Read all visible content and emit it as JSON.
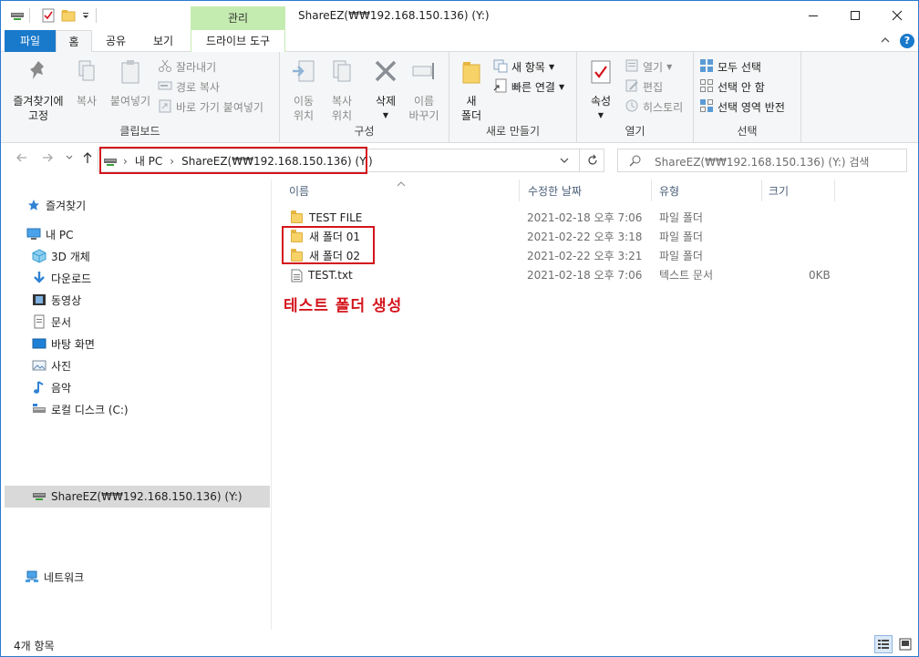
{
  "window": {
    "title": "ShareEZ(₩₩192.168.150.136) (Y:)",
    "context_tab_group": "관리"
  },
  "tabs": {
    "file": "파일",
    "home": "홈",
    "share": "공유",
    "view": "보기",
    "drive_tools": "드라이브 도구"
  },
  "ribbon": {
    "clipboard": {
      "label": "클립보드",
      "pin_line1": "즐겨찾기에",
      "pin_line2": "고정",
      "copy": "복사",
      "paste": "붙여넣기",
      "cut": "잘라내기",
      "copy_path": "경로 복사",
      "paste_shortcut": "바로 가기 붙여넣기"
    },
    "organize": {
      "label": "구성",
      "move_line1": "이동",
      "move_line2": "위치",
      "copyto_line1": "복사",
      "copyto_line2": "위치",
      "delete": "삭제",
      "rename_line1": "이름",
      "rename_line2": "바꾸기"
    },
    "new": {
      "label": "새로 만들기",
      "new_folder_line1": "새",
      "new_folder_line2": "폴더",
      "new_item": "새 항목",
      "easy_access": "빠른 연결"
    },
    "open": {
      "label": "열기",
      "properties": "속성",
      "open": "열기",
      "edit": "편집",
      "history": "히스토리"
    },
    "select": {
      "label": "선택",
      "select_all": "모두 선택",
      "select_none": "선택 안 함",
      "invert": "선택 영역 반전"
    }
  },
  "address": {
    "crumb_pc": "내 PC",
    "crumb_drive": "ShareEZ(₩₩192.168.150.136) (Y:)",
    "search_placeholder": "ShareEZ(₩₩192.168.150.136) (Y:) 검색"
  },
  "nav": {
    "quick_access": "즐겨찾기",
    "this_pc": "내 PC",
    "objects_3d": "3D 개체",
    "downloads": "다운로드",
    "videos": "동영상",
    "documents": "문서",
    "desktop": "바탕 화면",
    "pictures": "사진",
    "music": "음악",
    "local_disk": "로컬 디스크 (C:)",
    "share_drive": "ShareEZ(₩₩192.168.150.136) (Y:)",
    "network": "네트워크"
  },
  "columns": {
    "name": "이름",
    "modified": "수정한 날짜",
    "type": "유형",
    "size": "크기"
  },
  "files": [
    {
      "name": "TEST FILE",
      "modified": "2021-02-18 오후 7:06",
      "type": "파일 폴더",
      "size": ""
    },
    {
      "name": "새 폴더 01",
      "modified": "2021-02-22 오후 3:18",
      "type": "파일 폴더",
      "size": ""
    },
    {
      "name": "새 폴더 02",
      "modified": "2021-02-22 오후 3:21",
      "type": "파일 폴더",
      "size": ""
    },
    {
      "name": "TEST.txt",
      "modified": "2021-02-18 오후 7:06",
      "type": "텍스트 문서",
      "size": "0KB"
    }
  ],
  "annotation": "테스트 폴더 생성",
  "status": {
    "item_count": "4개 항목"
  },
  "colors": {
    "accent": "#1979ca",
    "context_tab": "#c5ecb0",
    "highlight": "#d4141c",
    "selection": "#d9d9d9"
  }
}
